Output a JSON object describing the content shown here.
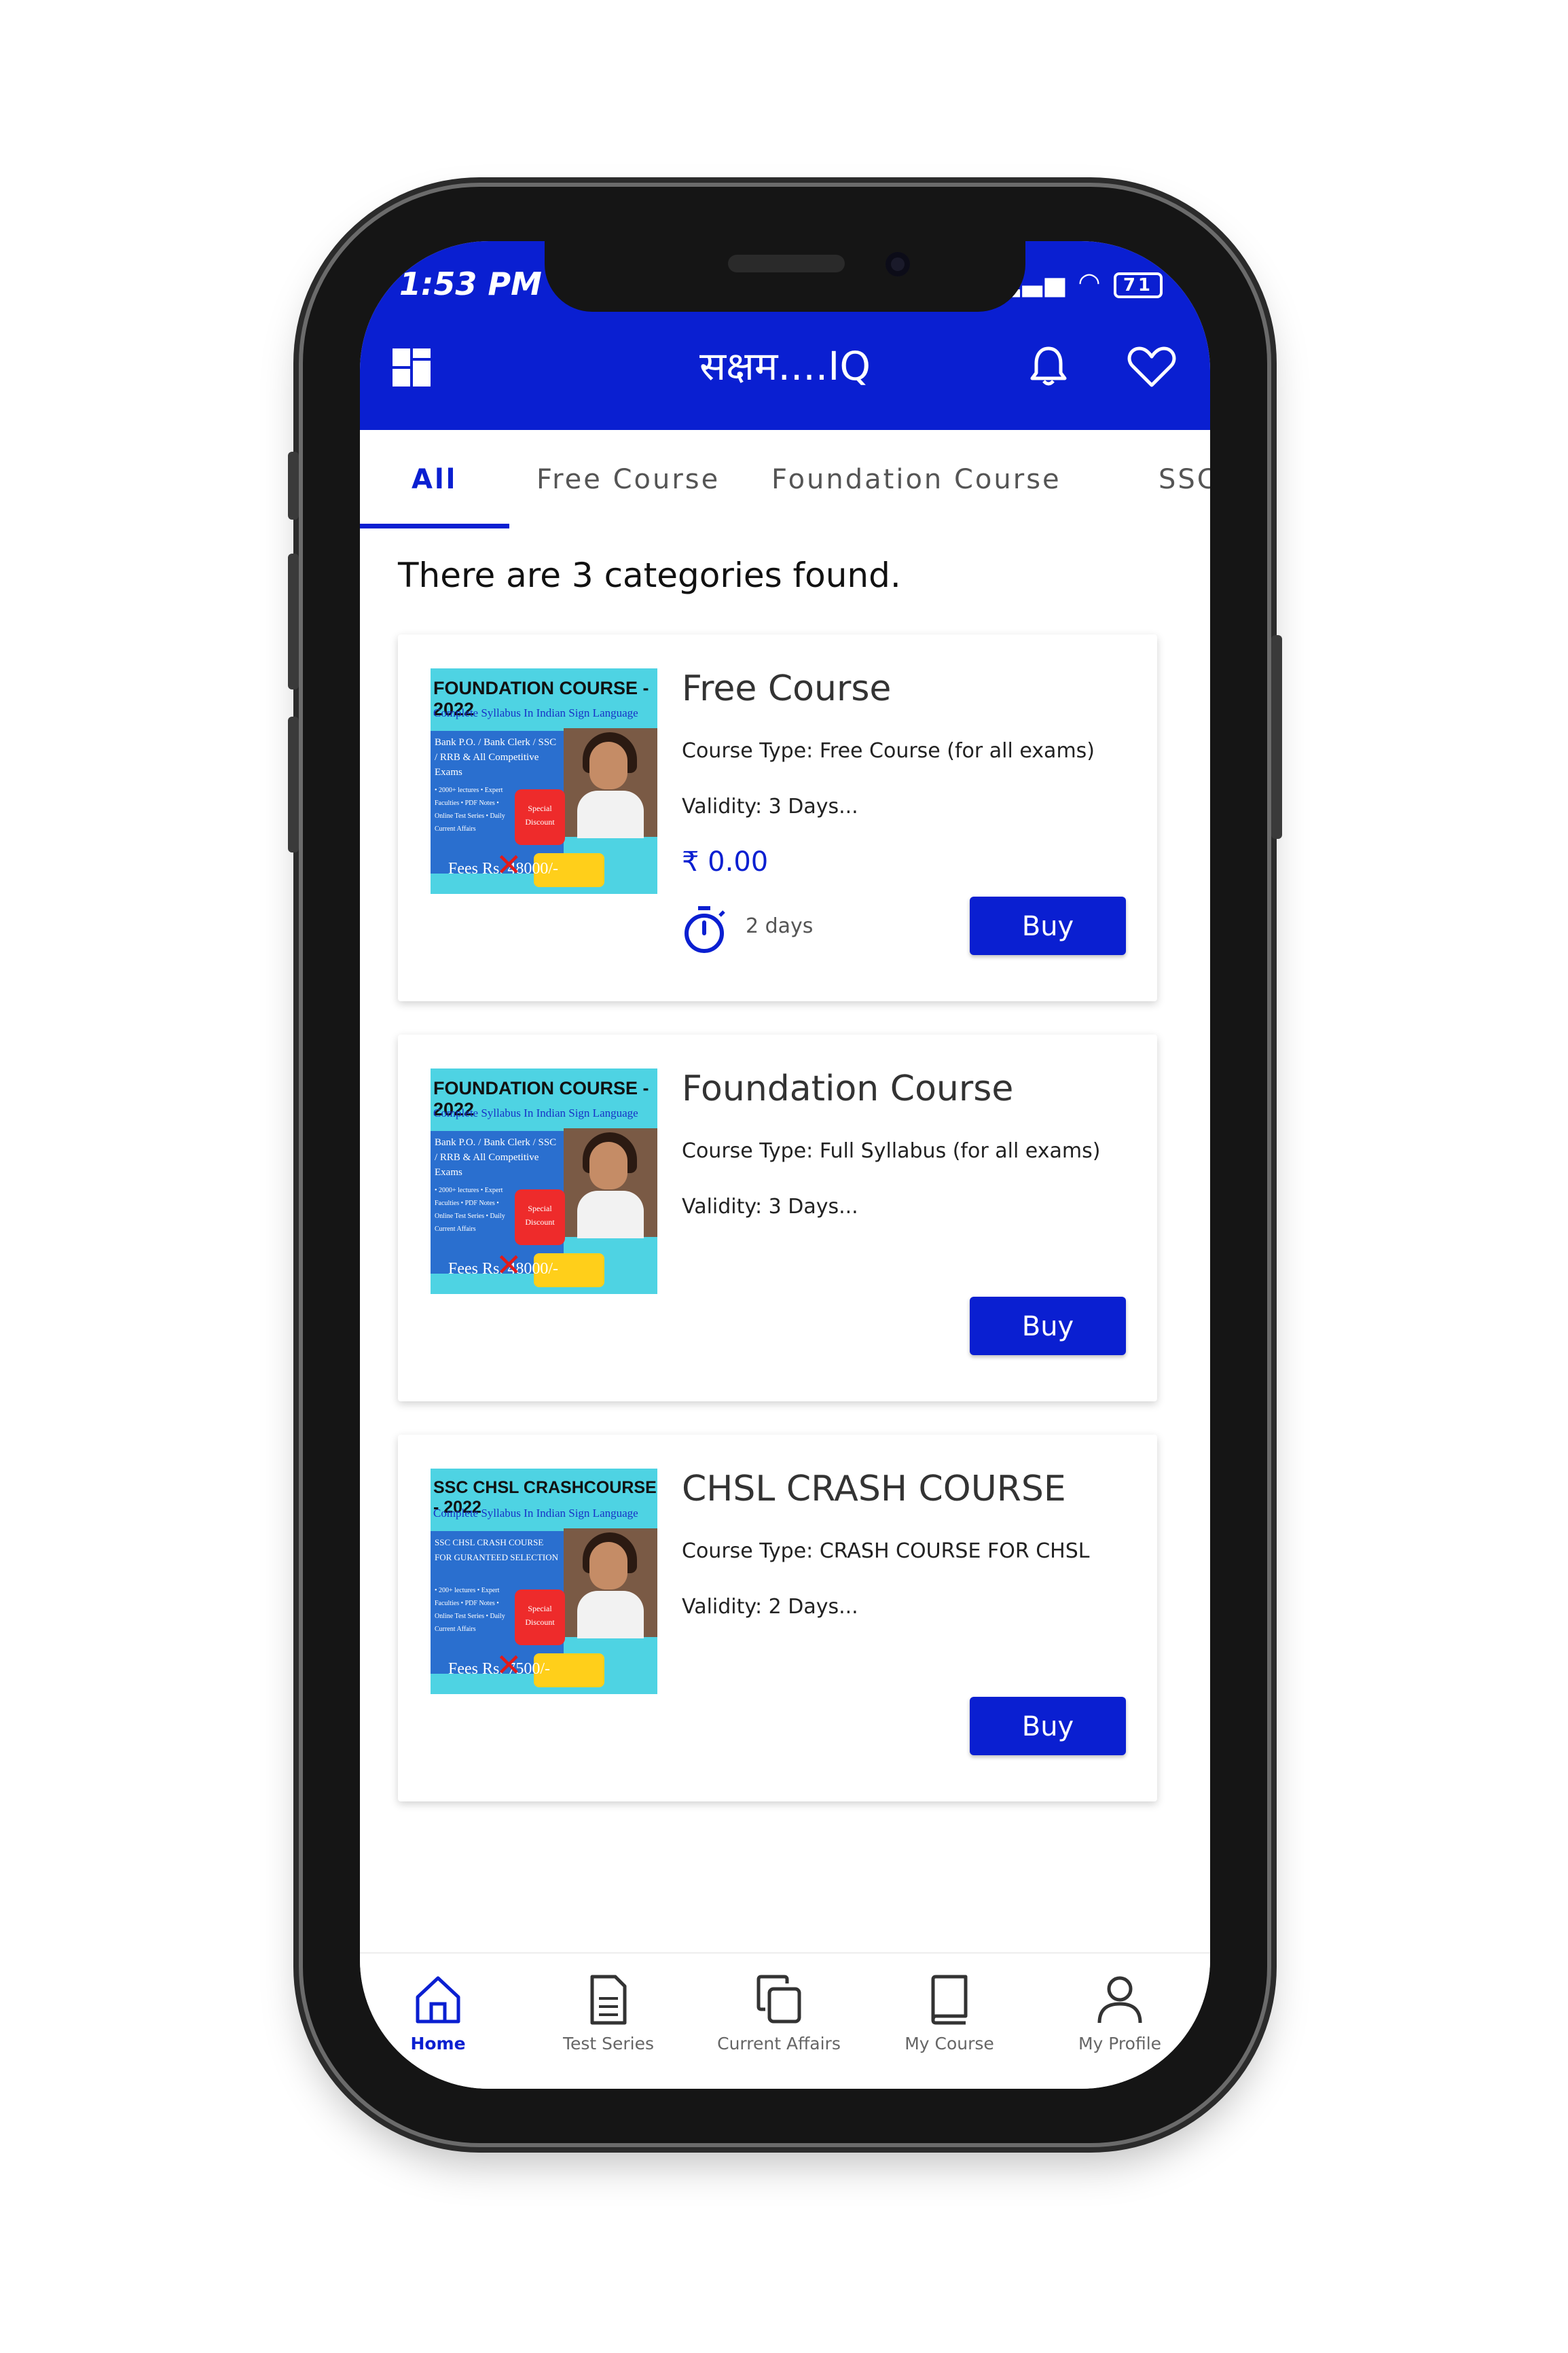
{
  "status": {
    "time": "1:53 PM",
    "battery": "71"
  },
  "header": {
    "title": "सक्षम....IQ"
  },
  "tabs": [
    {
      "label": "All"
    },
    {
      "label": "Free Course"
    },
    {
      "label": "Foundation Course"
    },
    {
      "label": "SSC"
    }
  ],
  "content": {
    "found_text": "There are 3 categories found."
  },
  "cards": [
    {
      "thumb": {
        "title": "FOUNDATION COURSE - 2022",
        "subtitle": "Complete Syllabus In Indian Sign Language",
        "blue_text": "Bank P.O. / Bank Clerk / SSC / RRB & All Competitive Exams",
        "bullets": "• 2000+ lectures • Expert Faculties • PDF Notes • Online Test Series • Daily Current Affairs",
        "badge": "Special Discount",
        "fees": "Fees Rs. 48000/-"
      },
      "title": "Free Course",
      "type": "Course Type: Free Course (for all exams)",
      "validity": "Validity: 3 Days...",
      "price": "₹ 0.00",
      "days": "2 days",
      "buy": "Buy"
    },
    {
      "thumb": {
        "title": "FOUNDATION COURSE - 2022",
        "subtitle": "Complete Syllabus In Indian Sign Language",
        "blue_text": "Bank P.O. / Bank Clerk / SSC / RRB & All Competitive Exams",
        "bullets": "• 2000+ lectures • Expert Faculties • PDF Notes • Online Test Series • Daily Current Affairs",
        "badge": "Special Discount",
        "fees": "Fees Rs. 48000/-"
      },
      "title": "Foundation Course",
      "type": "Course Type: Full Syllabus (for all exams)",
      "validity": "Validity: 3 Days...",
      "buy": "Buy"
    },
    {
      "thumb": {
        "title": "SSC CHSL CRASHCOURSE - 2022",
        "subtitle": "Complete Syllabus In Indian Sign Language",
        "blue_text": "SSC CHSL CRASH COURSE FOR GURANTEED SELECTION",
        "bullets": "• 200+ lectures • Expert Faculties • PDF Notes • Online Test Series • Daily Current Affairs",
        "badge": "Special Discount",
        "fees": "Fees Rs. 7500/-"
      },
      "title": "CHSL CRASH COURSE",
      "type": "Course Type: CRASH COURSE FOR CHSL",
      "validity": "Validity: 2 Days...",
      "buy": "Buy"
    }
  ],
  "bottom_nav": [
    {
      "label": "Home"
    },
    {
      "label": "Test Series"
    },
    {
      "label": "Current Affairs"
    },
    {
      "label": "My Course"
    },
    {
      "label": "My Profile"
    }
  ],
  "colors": {
    "primary": "#0a1fd1",
    "card_bg": "#ffffff",
    "thumb_bg": "#4ed3e3"
  }
}
